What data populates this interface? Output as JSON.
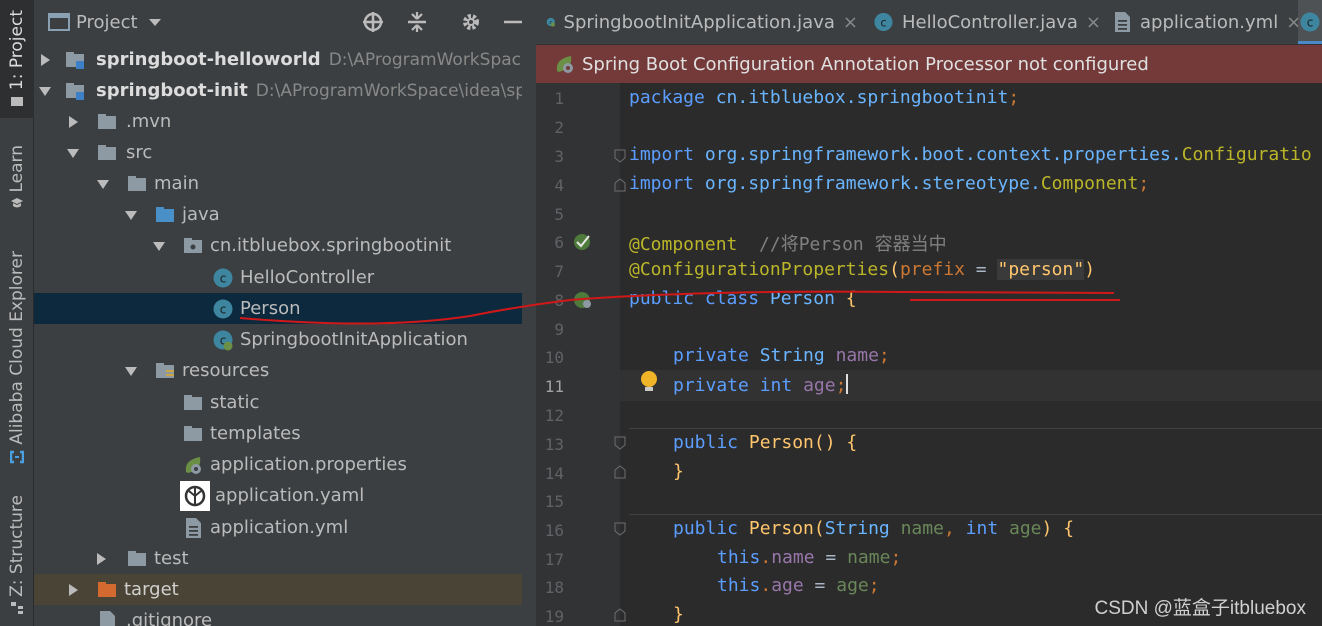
{
  "side_stripe": {
    "tabs": [
      "1: Project",
      "Learn",
      "Alibaba Cloud Explorer",
      "Z: Structure"
    ]
  },
  "project_panel": {
    "title": "Project",
    "tree": [
      {
        "label": "springboot-helloworld",
        "path": "D:\\AProgramWorkSpace\\idea"
      },
      {
        "label": "springboot-init",
        "path": "D:\\AProgramWorkSpace\\idea\\springb"
      },
      {
        "label": ".mvn"
      },
      {
        "label": "src"
      },
      {
        "label": "main"
      },
      {
        "label": "java"
      },
      {
        "label": "cn.itbluebox.springbootinit"
      },
      {
        "label": "HelloController"
      },
      {
        "label": "Person"
      },
      {
        "label": "SpringbootInitApplication"
      },
      {
        "label": "resources"
      },
      {
        "label": "static"
      },
      {
        "label": "templates"
      },
      {
        "label": "application.properties"
      },
      {
        "label": "application.yaml"
      },
      {
        "label": "application.yml"
      },
      {
        "label": "test"
      },
      {
        "label": "target"
      },
      {
        "label": ".gitignore"
      }
    ]
  },
  "editor": {
    "tabs": [
      {
        "label": "SpringbootInitApplication.java",
        "close": "×"
      },
      {
        "label": "HelloController.java",
        "close": "×"
      },
      {
        "label": "application.yml",
        "close": "×"
      }
    ],
    "banner": "Spring Boot Configuration Annotation Processor not configured",
    "line_numbers": [
      "1",
      "2",
      "3",
      "4",
      "5",
      "6",
      "7",
      "8",
      "9",
      "10",
      "11",
      "12",
      "13",
      "14",
      "15",
      "16",
      "17",
      "18",
      "19"
    ],
    "current_line": "11",
    "code": {
      "l1_kw": "package ",
      "l1_pkg": "cn.itbluebox.springbootinit",
      "l1_end": ";",
      "l3_kw": "import ",
      "l3_pkg": "org.springframework.boot.context.properties.",
      "l3_cls": "Configuratio",
      "l4_kw": "import ",
      "l4_pkg": "org.springframework.stereotype.",
      "l4_cls": "Component",
      "l4_end": ";",
      "l6_ann": "@Component",
      "l6_cmt": "  //将Person 容器当中",
      "l7_ann": "@ConfigurationProperties",
      "l7_p1": "(",
      "l7_attr": "prefix",
      "l7_eq": " = ",
      "l7_str": "\"person\"",
      "l7_p2": ")",
      "l8_kw": "public class ",
      "l8_cls": "Person",
      "l8_br": " {",
      "l10_kw": "private ",
      "l10_type": "String ",
      "l10_fld": "name",
      "l10_end": ";",
      "l11_kw": "private ",
      "l11_type": "int ",
      "l11_fld": "age",
      "l11_end": ";",
      "l13_kw": "public ",
      "l13_fn": "Person",
      "l13_rest": "() {",
      "l14": "}",
      "l16_kw": "public ",
      "l16_fn": "Person",
      "l16_p": "(",
      "l16_t1": "String ",
      "l16_a1": "name",
      "l16_c": ", ",
      "l16_t2": "int ",
      "l16_a2": "age",
      "l16_end": ") {",
      "l17_this": "this",
      "l17_dot": ".",
      "l17_fld": "name",
      "l17_eq": " = ",
      "l17_val": "name",
      "l17_end": ";",
      "l18_this": "this",
      "l18_dot": ".",
      "l18_fld": "age",
      "l18_eq": " = ",
      "l18_val": "age",
      "l18_end": ";",
      "l19": "}"
    }
  },
  "watermark": "CSDN @蓝盒子itbluebox"
}
